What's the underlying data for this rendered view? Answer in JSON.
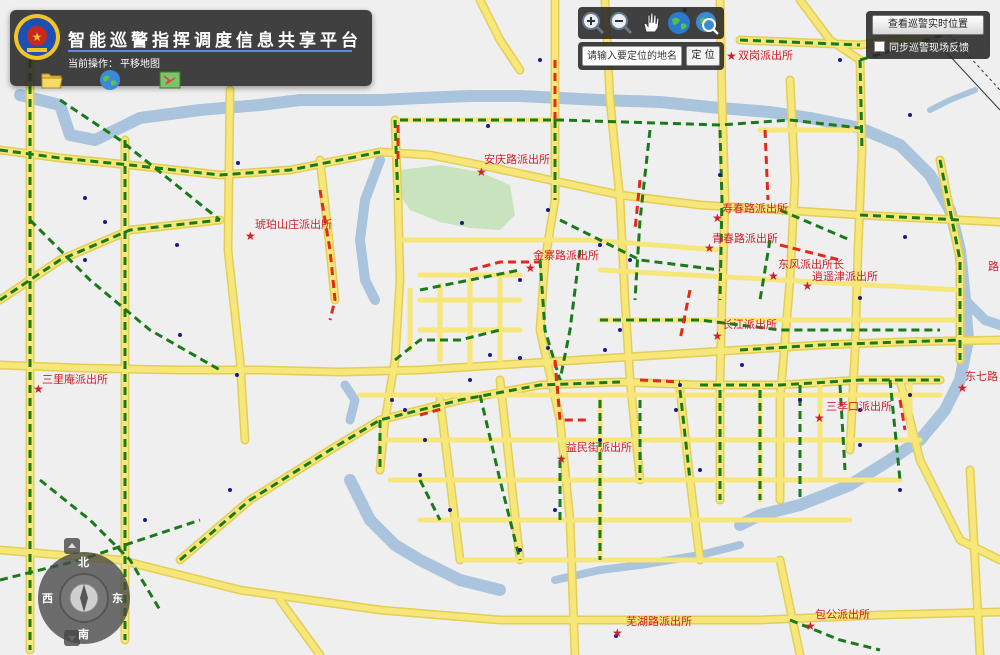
{
  "app": {
    "title": "智能巡警指挥调度信息共享平台",
    "operation_label": "当前操作：",
    "operation_value": "平移地图"
  },
  "toolbar": {
    "tools": [
      "folder-icon",
      "globe-icon",
      "map-icon"
    ]
  },
  "nav": {
    "buttons": [
      "zoom-in-icon",
      "zoom-out-icon",
      "pan-hand-icon",
      "full-extent-globe-icon",
      "globe-search-icon"
    ]
  },
  "search": {
    "placeholder": "请输入要定位的地名",
    "button_label": "定 位"
  },
  "right_panel": {
    "patrol_button_label": "查看巡警实时位置",
    "sync_label": "同步巡警现场反馈",
    "sync_checked": false
  },
  "compass": {
    "north": "北",
    "south": "南",
    "east": "东",
    "west": "西"
  },
  "places": {
    "shuanggang": "双岗派出所",
    "anqinglu": "安庆路派出所",
    "hupoShanzhuang": "琥珀山庄派出所",
    "shouchun": "寿春路派出所",
    "qingchun": "青春路派出所",
    "jinzhailu": "金寨路派出所",
    "dongfeng": "东风派出所长",
    "xiaoyaojin": "逍遥津派出所",
    "changjiang": "长江派出所",
    "sanliyan": "三里庵派出所",
    "sanxiaokou": "三孝口派出所",
    "yimin": "益民街派出所",
    "dongqi": "东七路",
    "baogong": "包公派出所",
    "wuhulu": "芜湖路派出所",
    "edge_label": "路"
  },
  "colors": {
    "road": "#f7e67a",
    "road_border": "#e2cf55",
    "water": "#a9c4dc",
    "park": "#c8e3bd",
    "patrol_route": "#1a7a1a",
    "alert_route": "#e02a1a",
    "label": "#d0202a",
    "panel_bg": "#2a2a2a",
    "title_text": "#ffffff"
  }
}
